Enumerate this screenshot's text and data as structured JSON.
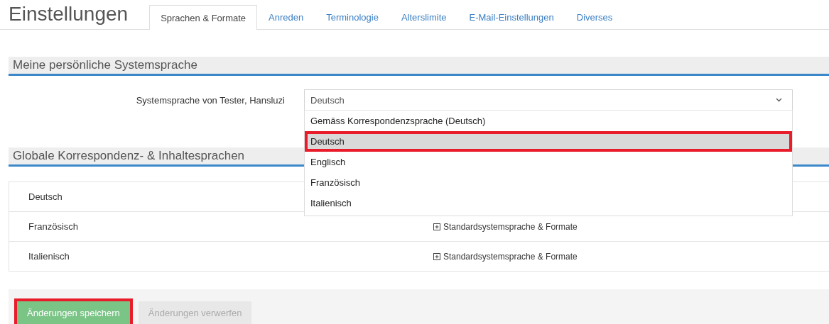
{
  "page_title": "Einstellungen",
  "tabs": [
    {
      "label": "Sprachen & Formate",
      "selected": true
    },
    {
      "label": "Anreden",
      "selected": false
    },
    {
      "label": "Terminologie",
      "selected": false
    },
    {
      "label": "Alterslimite",
      "selected": false
    },
    {
      "label": "E-Mail-Einstellungen",
      "selected": false
    },
    {
      "label": "Diverses",
      "selected": false
    }
  ],
  "system_language": {
    "heading": "Meine persönliche Systemsprache",
    "label": "Systemsprache von Tester, Hansluzi",
    "value": "Deutsch",
    "expanded": true,
    "options": [
      {
        "label": "Gemäss Korrespondenzsprache (Deutsch)",
        "selected": false,
        "highlighted": false
      },
      {
        "label": "Deutsch",
        "selected": true,
        "highlighted": true
      },
      {
        "label": "Englisch",
        "selected": false,
        "highlighted": false
      },
      {
        "label": "Französisch",
        "selected": false,
        "highlighted": false
      },
      {
        "label": "Italienisch",
        "selected": false,
        "highlighted": false
      }
    ]
  },
  "languages": {
    "heading": "Globale Korrespondenz- & Inhaltesprachen",
    "rows": [
      {
        "language": "Deutsch"
      },
      {
        "language": "Französisch",
        "action": "Standardsystemsprache & Formate"
      },
      {
        "language": "Italienisch",
        "action": "Standardsystemsprache & Formate"
      }
    ]
  },
  "buttons": [
    {
      "label": "Änderungen speichern",
      "kind": "primary",
      "disabled": false,
      "highlighted": true
    },
    {
      "label": "Änderungen verwerfen",
      "kind": "secondary",
      "disabled": true,
      "highlighted": false
    }
  ]
}
